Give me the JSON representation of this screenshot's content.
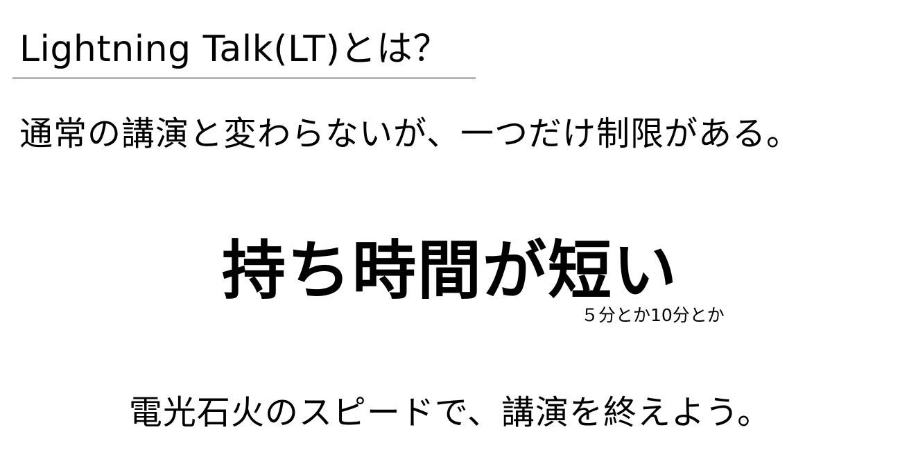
{
  "slide": {
    "title": "Lightning Talk(LT)とは？",
    "intro": "通常の講演と変わらないが、一つだけ制限がある。",
    "headline": "持ち時間が短い",
    "note": "５分とか10分とか",
    "closing": "電光石火のスピードで、講演を終えよう。"
  }
}
